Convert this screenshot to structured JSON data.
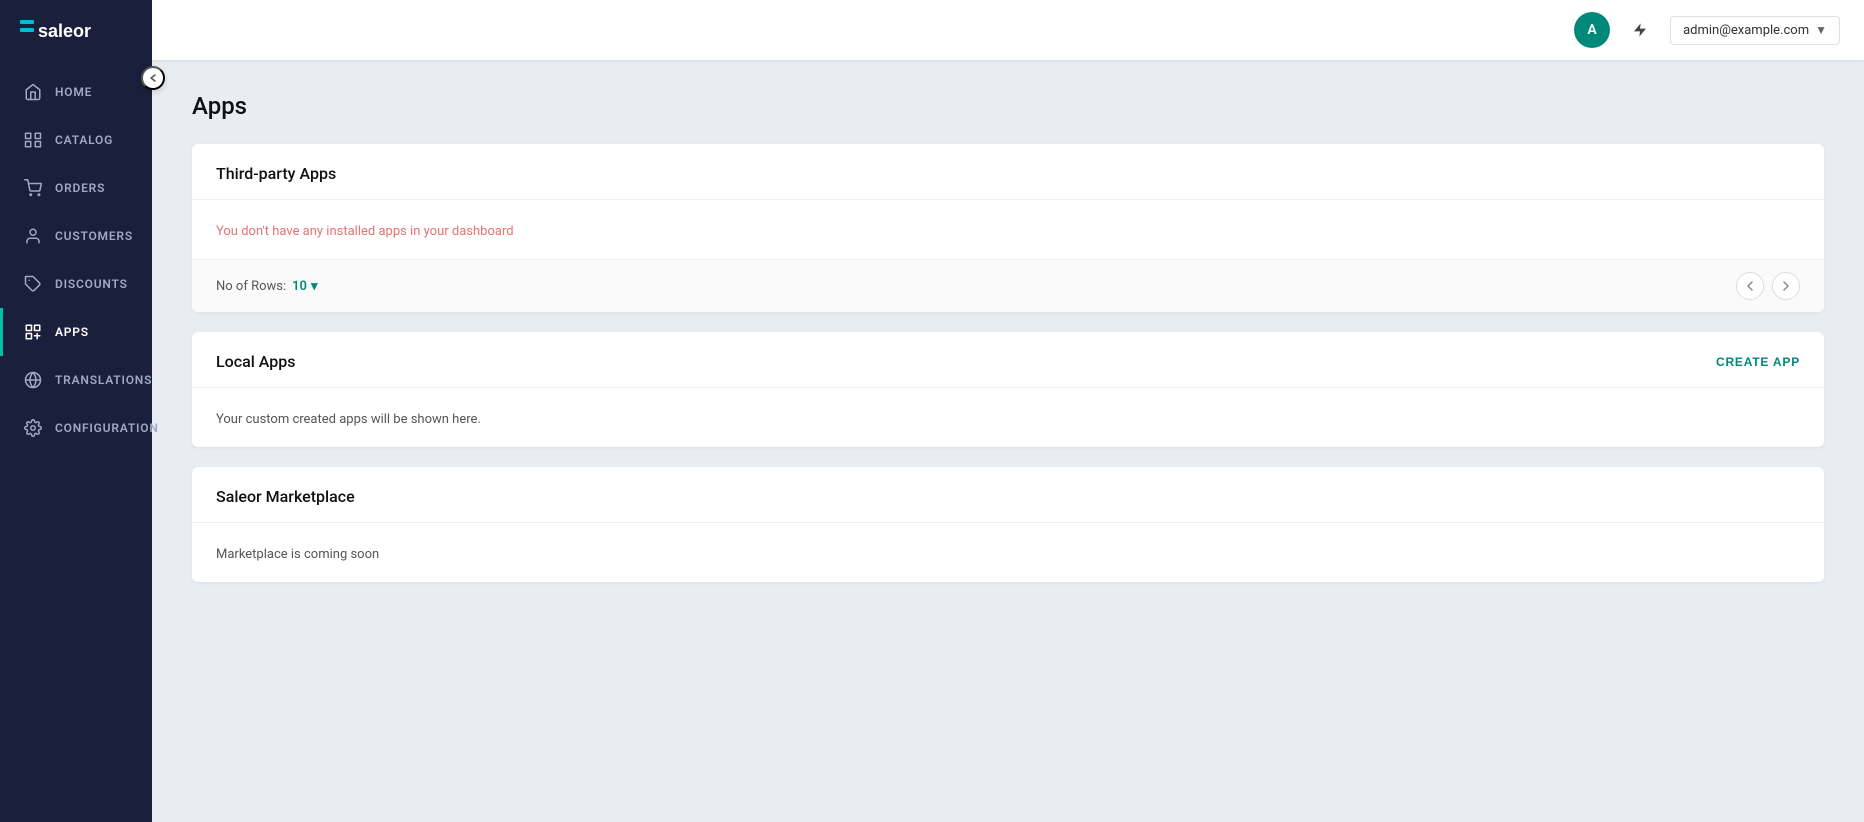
{
  "sidebar": {
    "logo": "saleor",
    "collapse_tooltip": "Collapse sidebar",
    "items": [
      {
        "id": "home",
        "label": "HOME",
        "icon": "home-icon"
      },
      {
        "id": "catalog",
        "label": "CATALOG",
        "icon": "catalog-icon"
      },
      {
        "id": "orders",
        "label": "ORDERS",
        "icon": "orders-icon"
      },
      {
        "id": "customers",
        "label": "CUSTOMERS",
        "icon": "customers-icon"
      },
      {
        "id": "discounts",
        "label": "DISCOUNTS",
        "icon": "discounts-icon"
      },
      {
        "id": "apps",
        "label": "APPS",
        "icon": "apps-icon",
        "active": true
      },
      {
        "id": "translations",
        "label": "TRANSLATIONS",
        "icon": "translations-icon"
      },
      {
        "id": "configuration",
        "label": "CONFIGURATION",
        "icon": "configuration-icon"
      }
    ]
  },
  "topbar": {
    "avatar_initials": "A",
    "user_email": "admin@example.com",
    "bolt_title": "Activity"
  },
  "page": {
    "title": "Apps"
  },
  "third_party_apps": {
    "title": "Third-party Apps",
    "empty_message": "You don't have any installed apps in your dashboard",
    "rows_label": "No of Rows:",
    "rows_value": "10"
  },
  "local_apps": {
    "title": "Local Apps",
    "create_btn_label": "CREATE APP",
    "empty_message": "Your custom created apps will be shown here."
  },
  "marketplace": {
    "title": "Saleor Marketplace",
    "message": "Marketplace is coming soon"
  }
}
